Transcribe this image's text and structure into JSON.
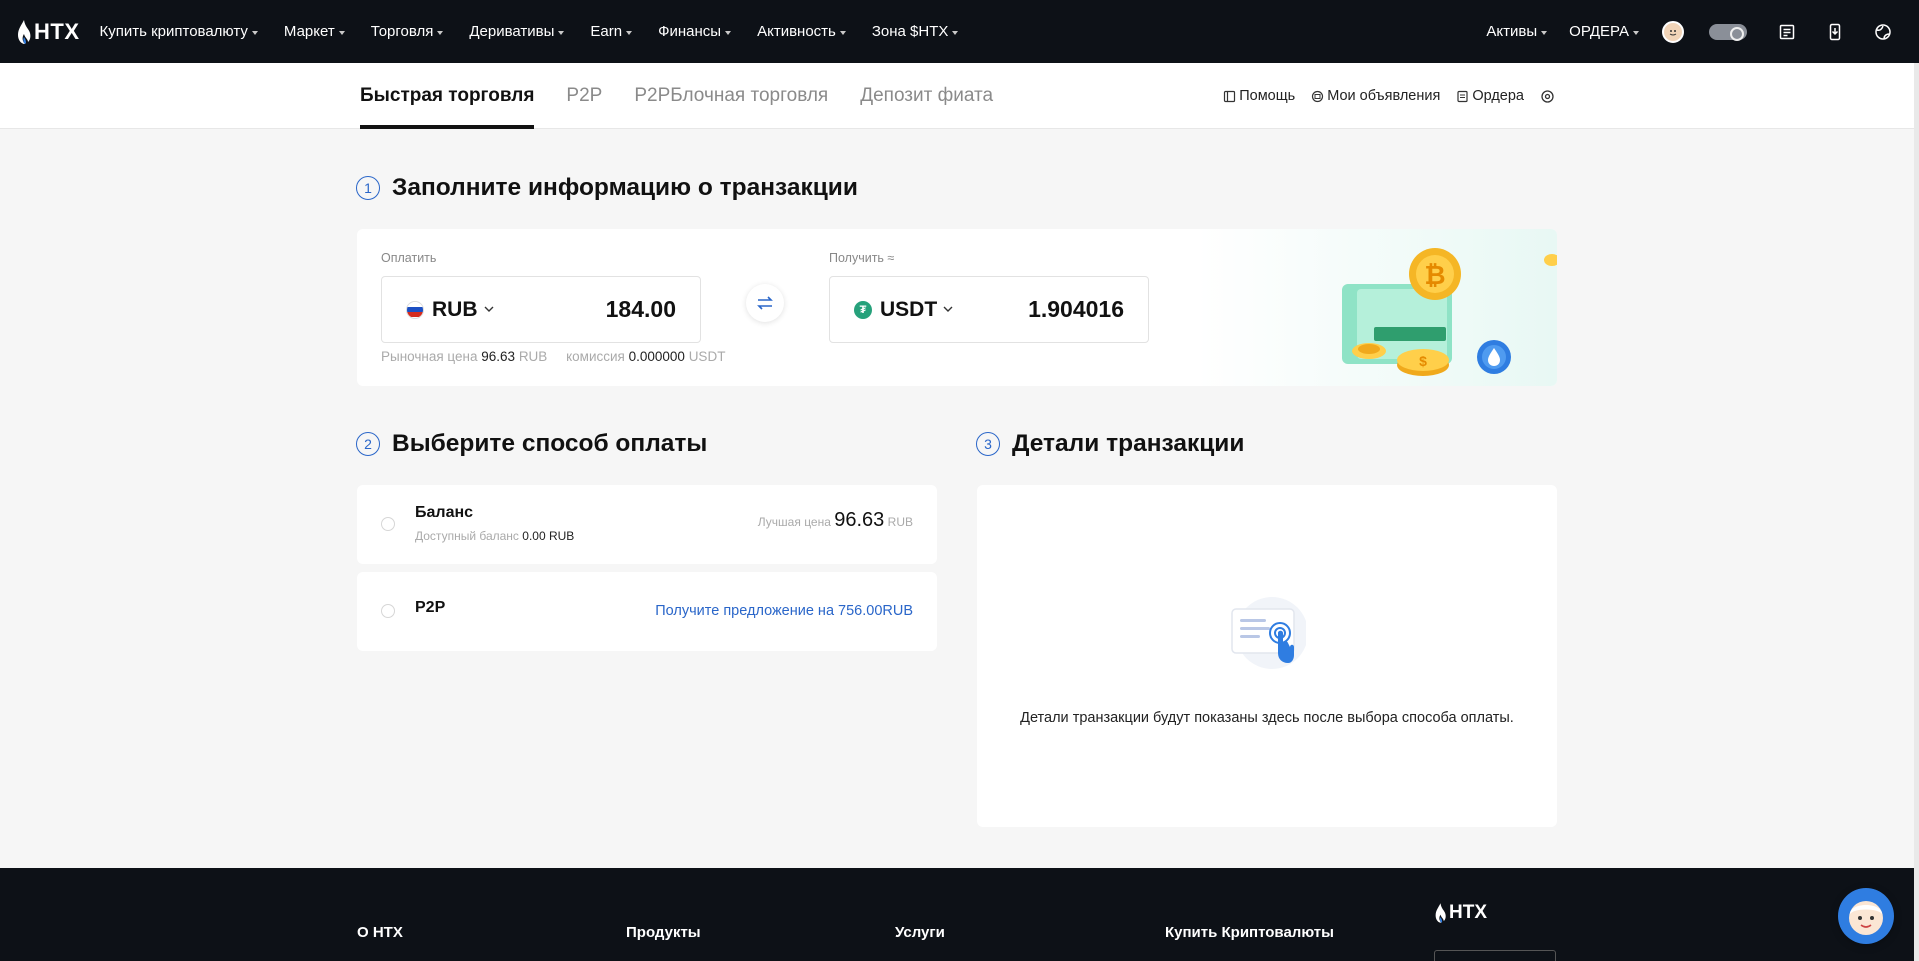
{
  "topnav": {
    "logo_text": "HTX",
    "items": [
      {
        "label": "Купить криптовалюту"
      },
      {
        "label": "Маркет"
      },
      {
        "label": "Торговля"
      },
      {
        "label": "Деривативы"
      },
      {
        "label": "Earn"
      },
      {
        "label": "Финансы"
      },
      {
        "label": "Активность"
      },
      {
        "label": "Зона $HTX"
      }
    ],
    "assets_label": "Активы",
    "orders_label": "ОРДЕРА"
  },
  "subnav": {
    "tabs": [
      {
        "label": "Быстрая торговля",
        "active": true
      },
      {
        "label": "P2P"
      },
      {
        "label": "P2PБлочная торговля"
      },
      {
        "label": "Депозит фиата"
      }
    ],
    "links": {
      "help": "Помощь",
      "my_ads": "Мои объявления",
      "orders": "Ордера"
    }
  },
  "step1": {
    "number": "1",
    "title": "Заполните информацию о транзакции",
    "pay_label": "Оплатить",
    "pay_currency": "RUB",
    "pay_amount": "184.00",
    "receive_label": "Получить ≈",
    "receive_currency": "USDT",
    "receive_amount": "1.904016",
    "market_price_label": "Рыночная цена",
    "market_price_value": "96.63",
    "market_price_unit": "RUB",
    "fee_label": "комиссия",
    "fee_value": "0.000000",
    "fee_unit": "USDT"
  },
  "step2": {
    "number": "2",
    "title": "Выберите способ оплаты",
    "options": [
      {
        "title": "Баланс",
        "sub_label": "Доступный баланс",
        "sub_value": "0.00 RUB",
        "best_price_label": "Лучшая цена",
        "best_price_value": "96.63",
        "best_price_unit": "RUB"
      },
      {
        "title": "P2P",
        "offer_text": "Получите предложение на 756.00RUB"
      }
    ]
  },
  "step3": {
    "number": "3",
    "title": "Детали транзакции",
    "empty_text": "Детали транзакции будут показаны здесь после выбора способа оплаты."
  },
  "footer": {
    "columns": [
      {
        "title": "О HTX"
      },
      {
        "title": "Продукты"
      },
      {
        "title": "Услуги"
      },
      {
        "title": "Купить Криптовалюты"
      }
    ],
    "logo_text": "HTX"
  },
  "colors": {
    "nav_bg": "#0d1117",
    "accent_blue": "#2a66c9",
    "page_bg": "#f6f6f6"
  }
}
